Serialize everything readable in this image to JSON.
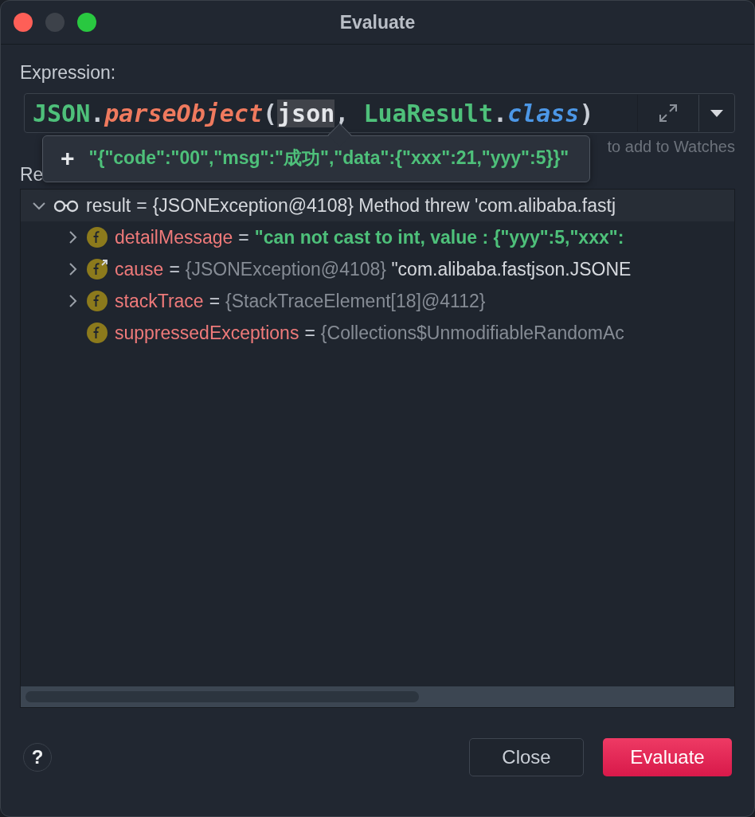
{
  "window": {
    "title": "Evaluate"
  },
  "expression": {
    "label": "Expression:",
    "tokens": [
      {
        "text": "JSON",
        "kind": "type"
      },
      {
        "text": ".",
        "kind": "plain"
      },
      {
        "text": "parseObject",
        "kind": "method"
      },
      {
        "text": "(",
        "kind": "plain"
      },
      {
        "text": "json",
        "kind": "highlight"
      },
      {
        "text": ", ",
        "kind": "plain"
      },
      {
        "text": "LuaResult",
        "kind": "type"
      },
      {
        "text": ".",
        "kind": "plain"
      },
      {
        "text": "class",
        "kind": "keyword"
      },
      {
        "text": ")",
        "kind": "plain"
      }
    ],
    "hint": "to add to Watches"
  },
  "tooltip": {
    "icon": "+",
    "value": "\"{\"code\":\"00\",\"msg\":\"成功\",\"data\":{\"xxx\":21,\"yyy\":5}}\""
  },
  "result": {
    "label": "Re",
    "tree": [
      {
        "kind": "watch",
        "expanded": true,
        "name": "result",
        "separator": "=",
        "value": [
          {
            "text": "{JSONException@4108}",
            "kind": "text"
          },
          {
            "text": " Method threw 'com.alibaba.fastj",
            "kind": "text"
          }
        ],
        "children": [
          {
            "kind": "field",
            "expanded": false,
            "name": "detailMessage",
            "separator": "=",
            "value": [
              {
                "text": "\"can not cast to int, value : {\"yyy\":5,\"xxx\":",
                "kind": "string"
              }
            ]
          },
          {
            "kind": "field-ref",
            "expanded": false,
            "name": "cause",
            "separator": "=",
            "value": [
              {
                "text": "{JSONException@4108}",
                "kind": "ref"
              },
              {
                "text": " \"com.alibaba.fastjson.JSONE",
                "kind": "text"
              }
            ]
          },
          {
            "kind": "field",
            "expanded": false,
            "name": "stackTrace",
            "separator": "=",
            "value": [
              {
                "text": "{StackTraceElement[18]@4112}",
                "kind": "ref"
              }
            ]
          },
          {
            "kind": "field",
            "name": "suppressedExceptions",
            "separator": "=",
            "value": [
              {
                "text": "{Collections$UnmodifiableRandomAc",
                "kind": "ref"
              }
            ]
          }
        ]
      }
    ]
  },
  "buttons": [
    {
      "label": "Close",
      "kind": "secondary"
    },
    {
      "label": "Evaluate",
      "kind": "primary"
    }
  ],
  "help": "?"
}
